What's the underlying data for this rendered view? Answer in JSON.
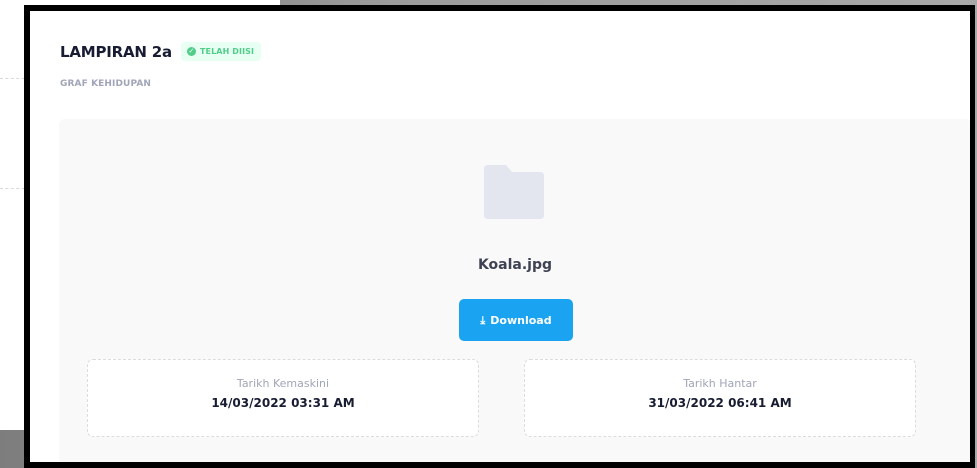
{
  "attachment": {
    "title": "LAMPIRAN 2a",
    "status_badge": "TELAH DIISI",
    "subtitle": "GRAF KEHIDUPAN",
    "file_name": "Koala.jpg",
    "download_label": "Download",
    "updated": {
      "label": "Tarikh Kemaskini",
      "value": "14/03/2022 03:31 AM"
    },
    "submitted": {
      "label": "Tarikh Hantar",
      "value": "31/03/2022 06:41 AM"
    }
  },
  "icons": {
    "status": "check-circle-icon",
    "file": "folder-icon",
    "download": "download-icon"
  },
  "colors": {
    "primary": "#1aa3f0",
    "success": "#50cd89",
    "success_bg": "#e8fff3",
    "folder": "#e4e6ef"
  }
}
